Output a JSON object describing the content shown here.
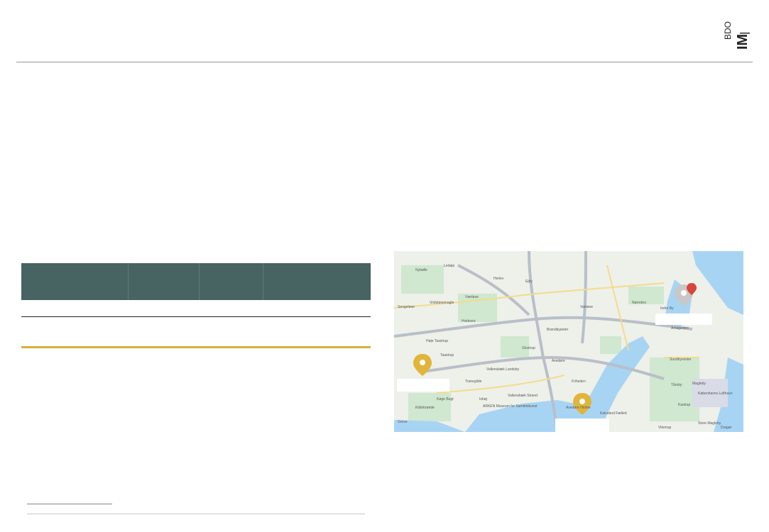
{
  "logo": {
    "mark": "IM",
    "sub": "BDO"
  },
  "table": {
    "headers": [
      "",
      "",
      "",
      ""
    ]
  },
  "map": {
    "accent_water": "#a8d4f4",
    "labels": [
      "Ledøje",
      "Nybølle",
      "Herlev",
      "Ejby",
      "Vanløse",
      "Nørrebro",
      "Indre By",
      "Amagerbro",
      "Værløse",
      "Sengeløse",
      "Vridsløsemagle",
      "Hvidovre",
      "Høje Taastrup",
      "Glostrup",
      "Brøndbyøster",
      "Taastrup",
      "Avedøre",
      "Sundbyvester",
      "Vallensbæk Landsby",
      "Tranegilde",
      "Friheden",
      "Tårnby",
      "Magleby",
      "Kastrup",
      "Ishøj",
      "Vallensbæk Strand",
      "ARKEN Museum for Samtidskunst",
      "Køge Bugt",
      "Kildebrønde",
      "Greve",
      "Avedøre Holme",
      "Vitemup",
      "Store Magleby",
      "Dragør",
      "Københavns Lufthavn",
      "Kalvebod Fælled"
    ]
  }
}
